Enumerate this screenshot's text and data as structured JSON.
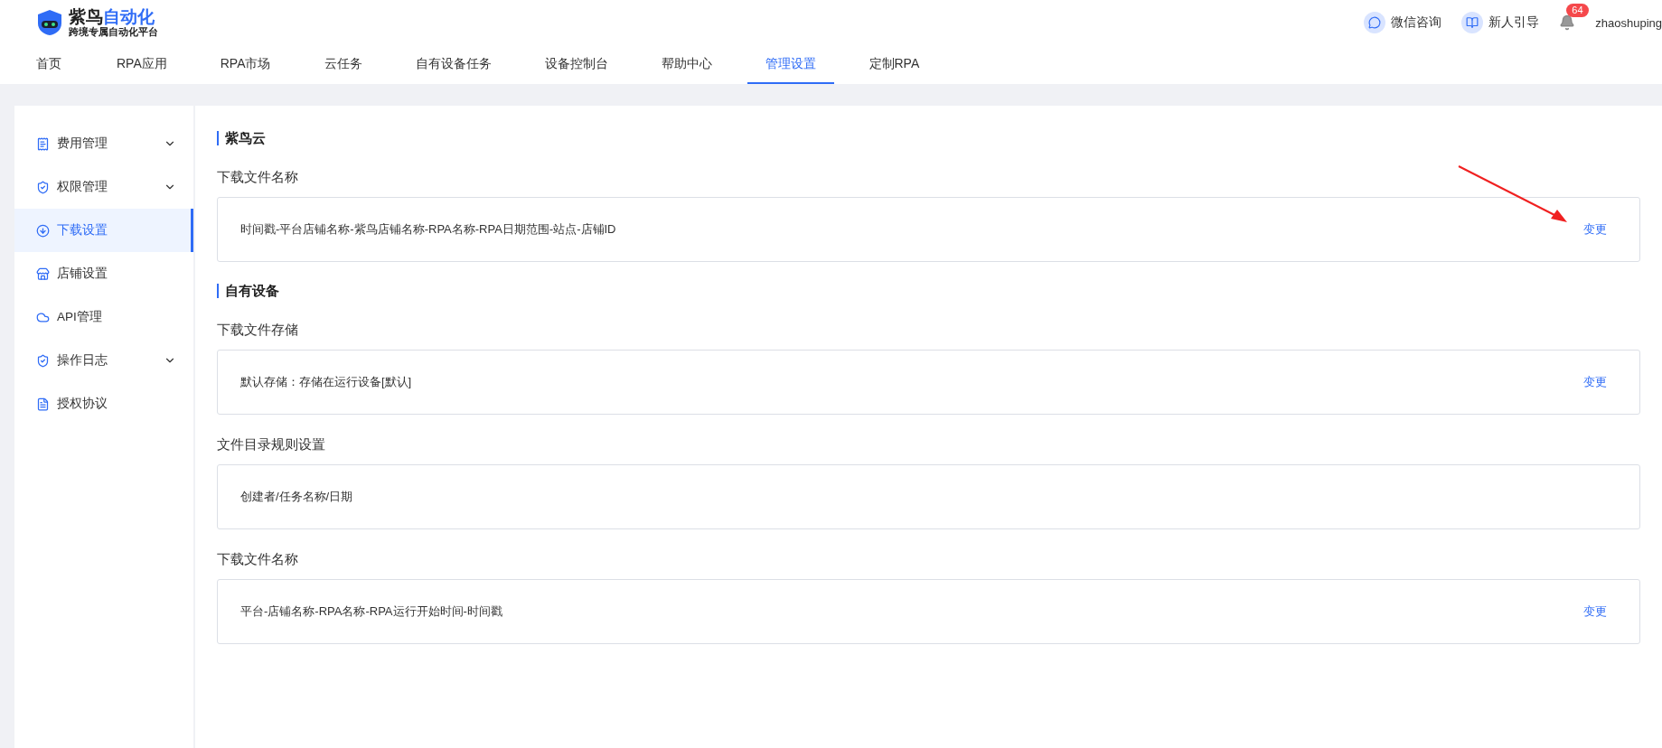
{
  "brand": {
    "name_main": "紫鸟",
    "name_accent": "自动化",
    "tagline": "跨境专属自动化平台"
  },
  "nav": [
    {
      "label": "首页",
      "selected": false
    },
    {
      "label": "RPA应用",
      "selected": false
    },
    {
      "label": "RPA市场",
      "selected": false
    },
    {
      "label": "云任务",
      "selected": false
    },
    {
      "label": "自有设备任务",
      "selected": false
    },
    {
      "label": "设备控制台",
      "selected": false
    },
    {
      "label": "帮助中心",
      "selected": false
    },
    {
      "label": "管理设置",
      "selected": true
    },
    {
      "label": "定制RPA",
      "selected": false
    }
  ],
  "header_actions": [
    {
      "label": "微信咨询"
    },
    {
      "label": "新人引导"
    }
  ],
  "notifications": {
    "count": "64"
  },
  "user": {
    "name": "zhaoshuping"
  },
  "sidebar": [
    {
      "label": "费用管理",
      "kind": "group",
      "expanded": false,
      "selected": false
    },
    {
      "label": "权限管理",
      "kind": "group",
      "expanded": false,
      "selected": false
    },
    {
      "label": "下载设置",
      "kind": "link",
      "selected": true
    },
    {
      "label": "店铺设置",
      "kind": "link",
      "selected": false
    },
    {
      "label": "API管理",
      "kind": "link",
      "selected": false
    },
    {
      "label": "操作日志",
      "kind": "group",
      "expanded": false,
      "selected": false
    },
    {
      "label": "授权协议",
      "kind": "link",
      "selected": false
    }
  ],
  "sections": [
    {
      "title": "紫鸟云",
      "settings": [
        {
          "label": "下载文件名称",
          "value": "时间戳-平台店铺名称-紫鸟店铺名称-RPA名称-RPA日期范围-站点-店铺ID",
          "action": "变更"
        }
      ]
    },
    {
      "title": "自有设备",
      "settings": [
        {
          "label": "下载文件存储",
          "value": "默认存储：存储在运行设备[默认]",
          "action": "变更"
        },
        {
          "label": "文件目录规则设置",
          "value": "创建者/任务名称/日期"
        },
        {
          "label": "下载文件名称",
          "value": "平台-店铺名称-RPA名称-RPA运行开始时间-时间戳",
          "action": "变更"
        }
      ]
    }
  ]
}
